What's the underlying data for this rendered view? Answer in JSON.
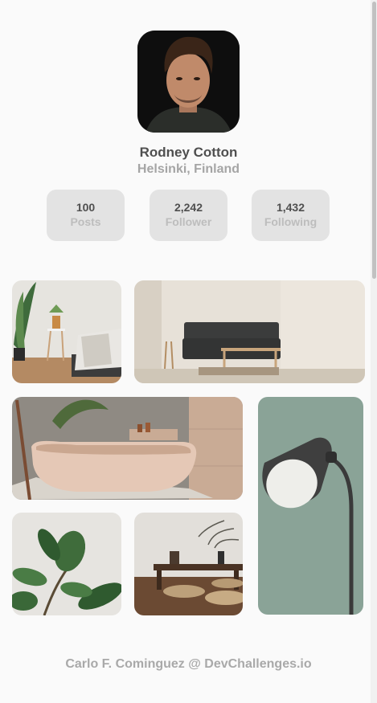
{
  "profile": {
    "name": "Rodney Cotton",
    "location": "Helsinki, Finland"
  },
  "stats": [
    {
      "value": "100",
      "label": "Posts"
    },
    {
      "value": "2,242",
      "label": "Follower"
    },
    {
      "value": "1,432",
      "label": "Following"
    }
  ],
  "gallery": [
    {
      "subject": "bedroom-photo"
    },
    {
      "subject": "living-room-photo"
    },
    {
      "subject": "bathtub-photo"
    },
    {
      "subject": "floor-lamp-photo"
    },
    {
      "subject": "plant-photo"
    },
    {
      "subject": "tea-table-photo"
    }
  ],
  "footer": {
    "credit": "Carlo F. Cominguez @ DevChallenges.io"
  }
}
